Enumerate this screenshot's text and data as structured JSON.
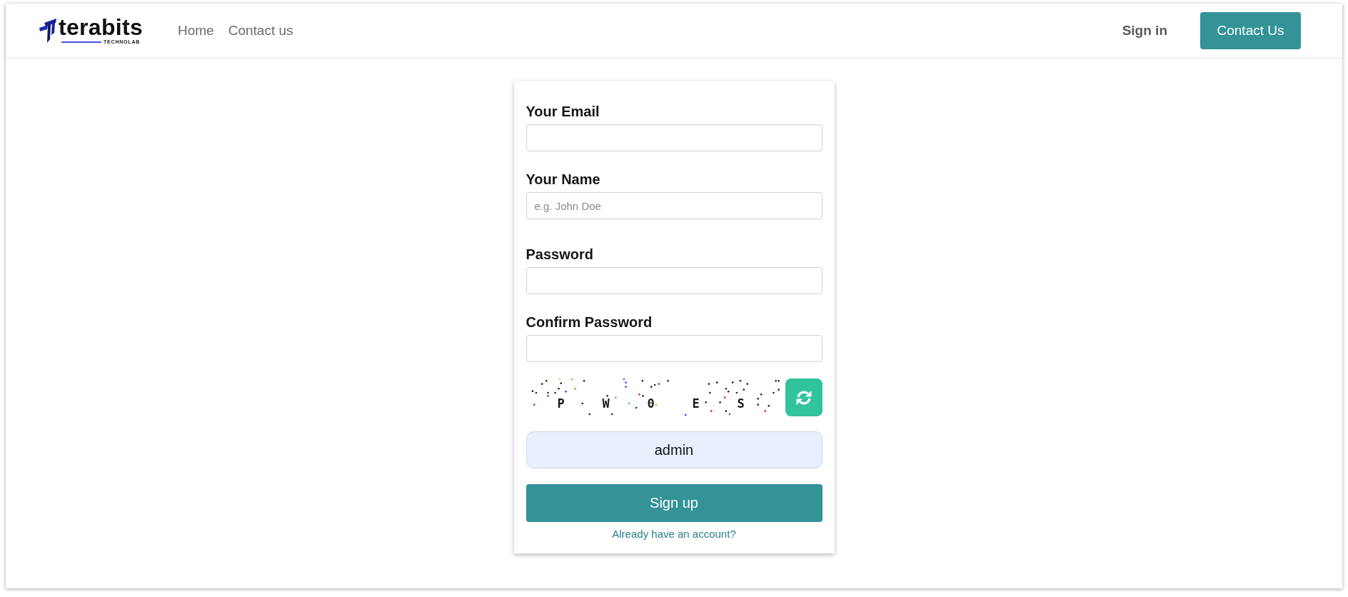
{
  "header": {
    "logo": {
      "name": "terabits",
      "tagline": "TECHNOLAB"
    },
    "nav_links": [
      {
        "label": "Home"
      },
      {
        "label": "Contact us"
      }
    ],
    "sign_in": "Sign in",
    "contact_button": "Contact Us"
  },
  "form": {
    "fields": [
      {
        "label": "Your Email"
      },
      {
        "label": "Your Name",
        "placeholder": "e.g. John Doe"
      },
      {
        "label": "Password"
      },
      {
        "label": "Confirm Password"
      }
    ],
    "captcha": {
      "characters": [
        "P",
        "W",
        "0",
        "E",
        "S"
      ]
    },
    "captcha_answer": {
      "value": "admin"
    },
    "submit": "Sign up",
    "login_link": "Already have an account?"
  }
}
